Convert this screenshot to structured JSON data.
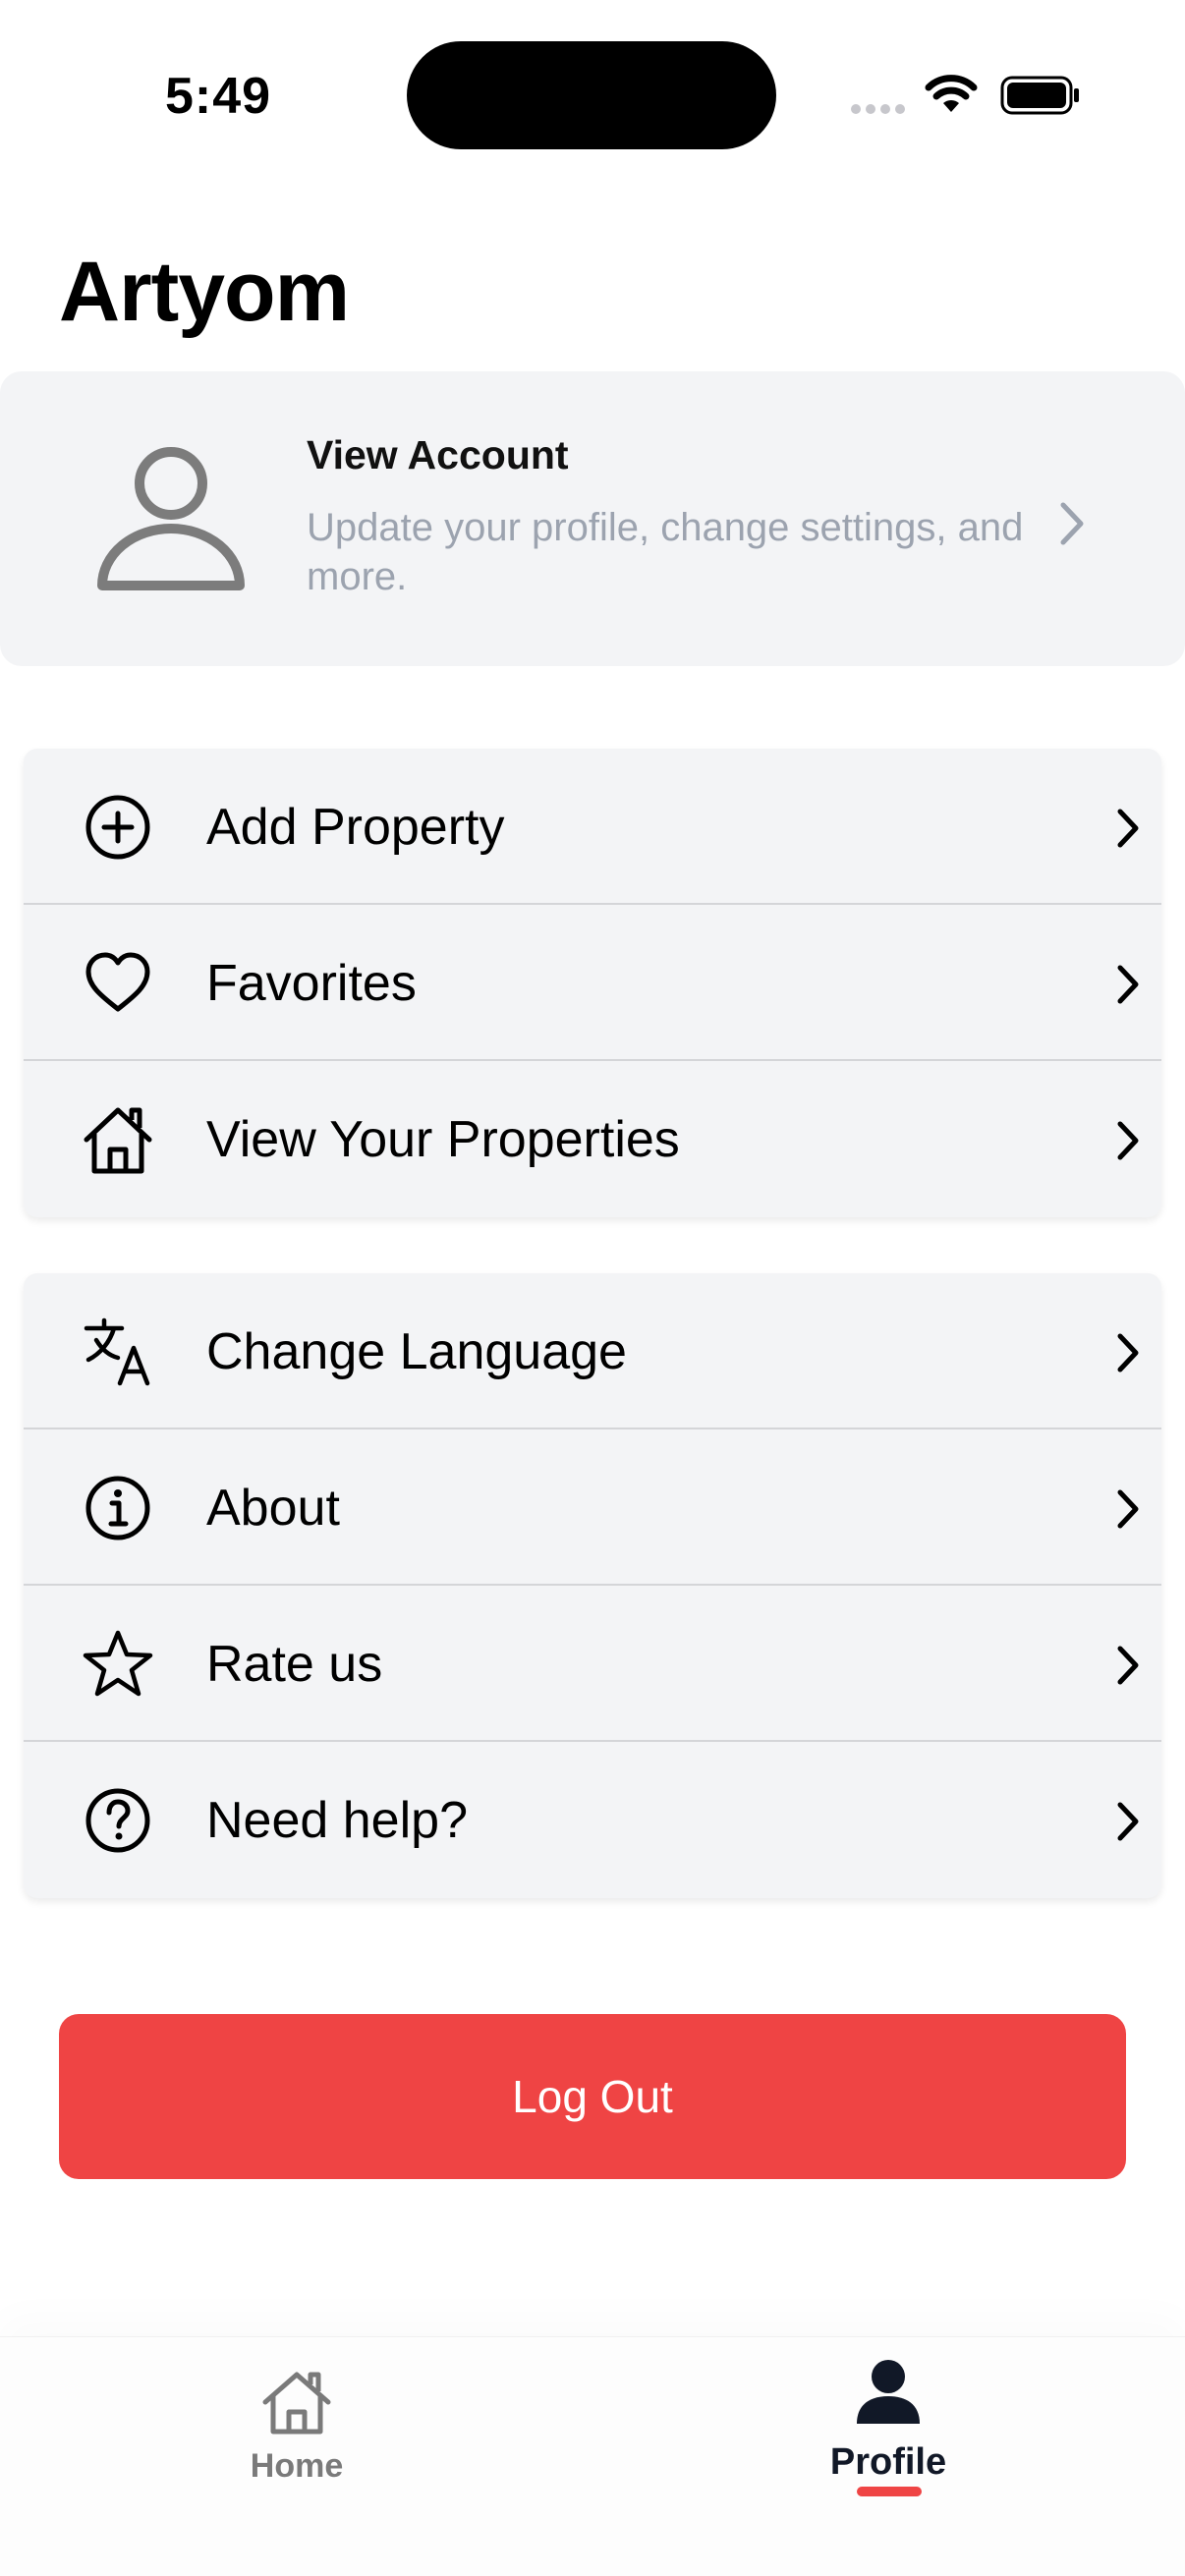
{
  "status_bar": {
    "time": "5:49"
  },
  "header": {
    "title": "Artyom"
  },
  "account": {
    "title": "View Account",
    "subtitle": "Update your profile, change settings, and more."
  },
  "menu_primary": [
    {
      "label": "Add Property",
      "icon": "plus-circle-icon"
    },
    {
      "label": "Favorites",
      "icon": "heart-icon"
    },
    {
      "label": "View Your Properties",
      "icon": "house-icon"
    }
  ],
  "menu_secondary": [
    {
      "label": "Change Language",
      "icon": "translate-icon"
    },
    {
      "label": "About",
      "icon": "info-icon"
    },
    {
      "label": "Rate us",
      "icon": "star-icon"
    },
    {
      "label": "Need help?",
      "icon": "question-icon"
    }
  ],
  "logout": {
    "label": "Log Out"
  },
  "tab_bar": {
    "tabs": [
      {
        "label": "Home",
        "icon": "home-icon",
        "active": false
      },
      {
        "label": "Profile",
        "icon": "person-icon",
        "active": true
      }
    ]
  },
  "colors": {
    "accent": "#ef4444",
    "card_background": "#f3f4f6",
    "muted_text": "#9ca3af"
  }
}
